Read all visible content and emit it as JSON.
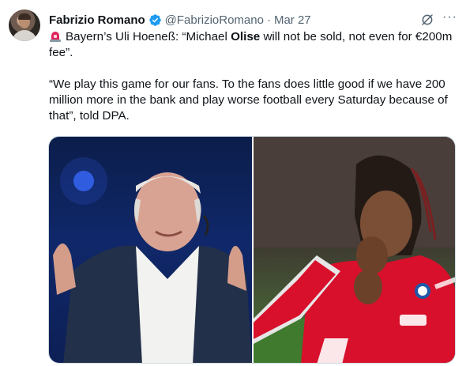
{
  "tweet": {
    "author_name": "Fabrizio Romano",
    "handle": "@FabrizioRomano",
    "separator": "·",
    "date": "Mar 27",
    "more_label": "···",
    "paragraph1_prefix": "Bayern’s Uli Hoeneß: “Michael ",
    "paragraph1_bold": "Olise",
    "paragraph1_suffix": " will not be sold, not even for €200m fee”.",
    "paragraph2": "“We play this game for our fans. To the fans does little good if we have 200 million more in the bank and play worse football every Saturday because of that”, told DPA."
  },
  "icons": {
    "verified": "verified-badge-icon",
    "siren": "rotating-light-icon",
    "grok": "grok-icon",
    "more": "more-horizontal-icon"
  },
  "colors": {
    "verified": "#1d9bf0",
    "secondary_text": "#536471",
    "siren": "#e0245e"
  }
}
